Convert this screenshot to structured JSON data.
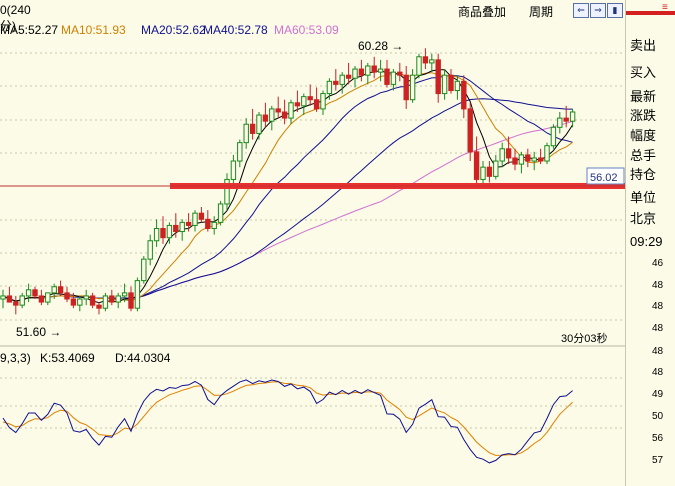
{
  "header": {
    "period_label": "0(240分)",
    "ma_labels": [
      {
        "text": "MA5:52.27",
        "color": "#000000"
      },
      {
        "text": "MA10:51.93",
        "color": "#d08000"
      },
      {
        "text": "MA20:52.62",
        "color": "#101090"
      },
      {
        "text": "MA40:52.78",
        "color": "#101090"
      },
      {
        "text": "MA60:53.09",
        "color": "#d070d0"
      }
    ],
    "menu_overlay": "商品叠加",
    "menu_period": "周期",
    "btn_glyphs": [
      "⇐",
      "⇒",
      "▮"
    ]
  },
  "sidebar": {
    "top_mark": "≡",
    "labels": [
      "卖出",
      "买入",
      "最新",
      "涨跌",
      "幅度",
      "总手",
      "持仓",
      "单位",
      "北京",
      "09:29"
    ],
    "values": [
      "46",
      "48",
      "48",
      "48",
      "48",
      "48",
      "49",
      "50",
      "56",
      "57"
    ]
  },
  "kdj": {
    "title": "9,3,3)",
    "k": "K:53.4069",
    "d": "D:44.0304",
    "k_color": "#101090",
    "d_color": "#e08000"
  },
  "countdown": "30分03秒",
  "chart_data": {
    "type": "candlestick",
    "price_label": "56.02",
    "annotations": {
      "high": "60.28",
      "low": "51.60"
    },
    "colors": {
      "up": "#1a8a1a",
      "down": "#cc2222",
      "ma5": "#000000",
      "ma10": "#d08000",
      "ma20": "#101090",
      "ma40": "#101090",
      "ma60": "#d070d0",
      "support": "#e83030"
    },
    "ohlc": [
      [
        52.1,
        52.4,
        51.8,
        52.2
      ],
      [
        52.2,
        52.5,
        52.0,
        52.0
      ],
      [
        52.0,
        52.2,
        51.6,
        51.9
      ],
      [
        51.9,
        52.3,
        51.8,
        52.2
      ],
      [
        52.2,
        52.6,
        52.0,
        52.4
      ],
      [
        52.4,
        52.5,
        52.1,
        52.2
      ],
      [
        52.2,
        52.4,
        51.9,
        52.0
      ],
      [
        52.0,
        52.3,
        51.9,
        52.3
      ],
      [
        52.3,
        52.6,
        52.1,
        52.5
      ],
      [
        52.5,
        52.7,
        52.2,
        52.3
      ],
      [
        52.3,
        52.5,
        52.0,
        52.1
      ],
      [
        52.1,
        52.3,
        51.8,
        51.9
      ],
      [
        51.9,
        52.2,
        51.7,
        52.1
      ],
      [
        52.1,
        52.4,
        51.9,
        52.2
      ],
      [
        52.2,
        52.3,
        51.8,
        51.9
      ],
      [
        51.9,
        52.0,
        51.6,
        51.8
      ],
      [
        51.8,
        52.3,
        51.7,
        52.2
      ],
      [
        52.2,
        52.4,
        51.9,
        52.0
      ],
      [
        52.0,
        52.3,
        51.8,
        52.2
      ],
      [
        52.2,
        52.6,
        52.0,
        52.3
      ],
      [
        52.3,
        52.5,
        51.7,
        51.8
      ],
      [
        51.8,
        52.8,
        51.7,
        52.7
      ],
      [
        52.7,
        53.5,
        52.6,
        53.4
      ],
      [
        53.4,
        54.2,
        53.2,
        54.0
      ],
      [
        54.0,
        54.7,
        53.8,
        54.4
      ],
      [
        54.4,
        54.8,
        53.9,
        54.1
      ],
      [
        54.1,
        54.6,
        53.9,
        54.5
      ],
      [
        54.5,
        54.9,
        54.1,
        54.3
      ],
      [
        54.3,
        54.7,
        54.0,
        54.6
      ],
      [
        54.6,
        54.9,
        54.3,
        54.5
      ],
      [
        54.5,
        55.0,
        54.3,
        54.9
      ],
      [
        54.9,
        55.1,
        54.6,
        54.7
      ],
      [
        54.7,
        55.0,
        54.3,
        54.4
      ],
      [
        54.4,
        54.8,
        54.2,
        54.6
      ],
      [
        54.6,
        55.3,
        54.5,
        55.2
      ],
      [
        55.2,
        56.2,
        55.0,
        56.0
      ],
      [
        56.0,
        56.8,
        55.8,
        56.6
      ],
      [
        56.6,
        57.3,
        56.4,
        57.2
      ],
      [
        57.2,
        58.0,
        57.0,
        57.8
      ],
      [
        57.8,
        58.3,
        57.3,
        57.5
      ],
      [
        57.5,
        58.2,
        57.3,
        58.1
      ],
      [
        58.1,
        58.5,
        57.7,
        57.9
      ],
      [
        57.9,
        58.4,
        57.6,
        58.3
      ],
      [
        58.3,
        58.7,
        58.0,
        58.2
      ],
      [
        58.2,
        58.6,
        57.8,
        58.0
      ],
      [
        58.0,
        58.6,
        57.8,
        58.5
      ],
      [
        58.5,
        58.9,
        58.2,
        58.4
      ],
      [
        58.4,
        58.8,
        58.1,
        58.7
      ],
      [
        58.7,
        59.1,
        58.4,
        58.6
      ],
      [
        58.6,
        59.0,
        58.2,
        58.3
      ],
      [
        58.3,
        58.9,
        58.1,
        58.8
      ],
      [
        58.8,
        59.3,
        58.6,
        59.2
      ],
      [
        59.2,
        59.6,
        58.9,
        59.1
      ],
      [
        59.1,
        59.5,
        58.8,
        59.4
      ],
      [
        59.4,
        59.8,
        59.1,
        59.3
      ],
      [
        59.3,
        59.7,
        59.0,
        59.6
      ],
      [
        59.6,
        59.9,
        59.2,
        59.4
      ],
      [
        59.4,
        59.8,
        59.1,
        59.7
      ],
      [
        59.7,
        60.0,
        59.3,
        59.5
      ],
      [
        59.5,
        59.9,
        59.2,
        59.6
      ],
      [
        59.6,
        59.9,
        59.0,
        59.1
      ],
      [
        59.1,
        59.6,
        58.9,
        59.5
      ],
      [
        59.5,
        59.8,
        59.2,
        59.4
      ],
      [
        59.4,
        59.7,
        58.3,
        58.6
      ],
      [
        58.6,
        59.6,
        58.5,
        59.4
      ],
      [
        59.4,
        60.1,
        59.3,
        60.0
      ],
      [
        60.0,
        60.28,
        59.6,
        59.8
      ],
      [
        59.8,
        60.1,
        59.5,
        59.9
      ],
      [
        59.9,
        60.1,
        58.5,
        58.8
      ],
      [
        58.8,
        59.6,
        58.6,
        59.4
      ],
      [
        59.4,
        59.6,
        58.8,
        58.9
      ],
      [
        58.9,
        59.4,
        58.6,
        59.2
      ],
      [
        59.2,
        59.4,
        58.0,
        58.3
      ],
      [
        58.3,
        58.5,
        56.6,
        56.9
      ],
      [
        56.9,
        57.4,
        55.8,
        56.0
      ],
      [
        56.0,
        56.6,
        55.8,
        56.4
      ],
      [
        56.4,
        56.6,
        55.9,
        56.1
      ],
      [
        56.1,
        56.8,
        56.0,
        56.6
      ],
      [
        56.6,
        57.2,
        56.4,
        57.0
      ],
      [
        57.0,
        57.4,
        56.5,
        56.7
      ],
      [
        56.7,
        57.0,
        56.3,
        56.5
      ],
      [
        56.5,
        56.9,
        56.2,
        56.8
      ],
      [
        56.8,
        57.0,
        56.4,
        56.6
      ],
      [
        56.6,
        56.9,
        56.3,
        56.7
      ],
      [
        56.7,
        57.0,
        56.5,
        56.6
      ],
      [
        56.6,
        57.2,
        56.5,
        57.1
      ],
      [
        57.1,
        57.8,
        57.0,
        57.7
      ],
      [
        57.7,
        58.2,
        57.5,
        58.0
      ],
      [
        58.0,
        58.4,
        57.7,
        57.9
      ],
      [
        57.9,
        58.3,
        57.7,
        58.2
      ]
    ]
  }
}
